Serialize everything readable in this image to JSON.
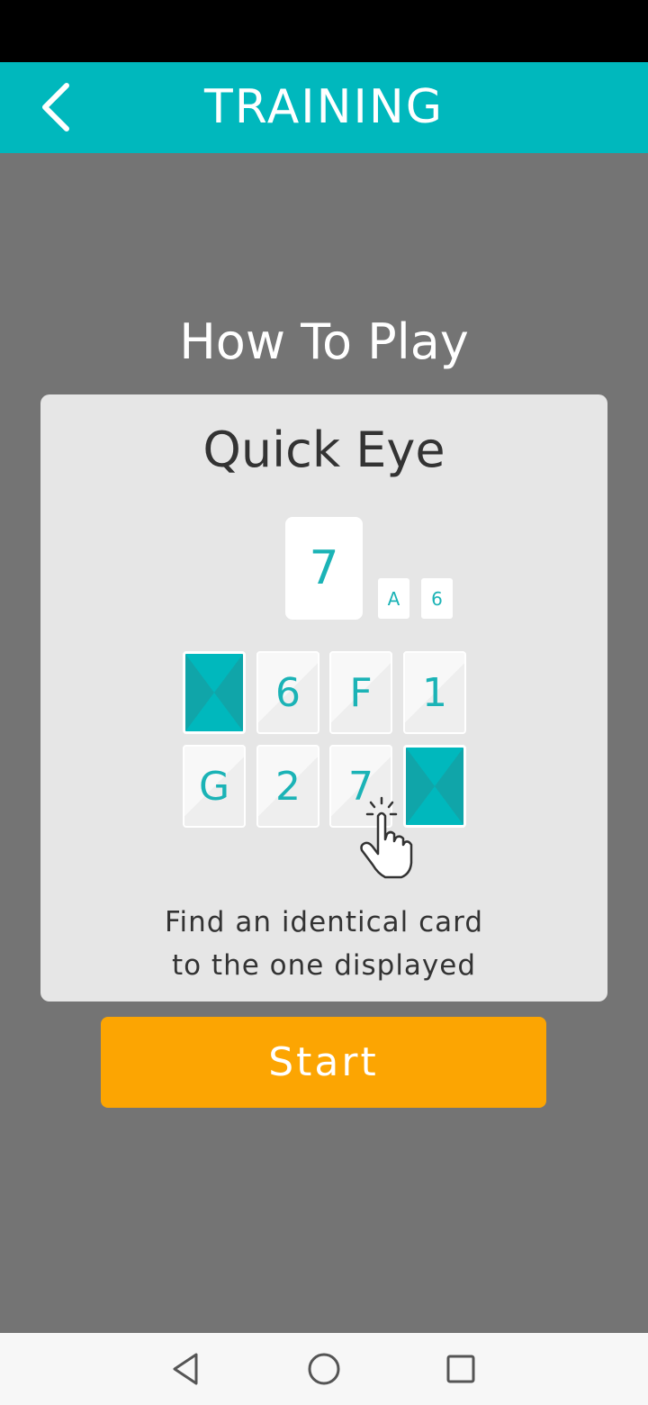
{
  "header": {
    "title": "TRAINING",
    "back_icon": "chevron-left-icon"
  },
  "instructions": {
    "heading": "How To Play",
    "game_title": "Quick Eye",
    "target_card": "7",
    "mini_cards": [
      "A",
      "6"
    ],
    "grid_row1": [
      "",
      "6",
      "F",
      "1"
    ],
    "grid_row2": [
      "G",
      "2",
      "7",
      ""
    ],
    "face_down_cards": [
      "row1-col1",
      "row2-col4"
    ],
    "tap_icon": "tap-hand-icon",
    "description_line1": "Find an identical card",
    "description_line2": "to the one displayed"
  },
  "start_button": {
    "label": "Start"
  },
  "nav": {
    "back_icon": "triangle-back-icon",
    "home_icon": "circle-home-icon",
    "recents_icon": "square-recents-icon"
  },
  "colors": {
    "accent": "#00b8bd",
    "button": "#fca502",
    "background": "#747474",
    "panel": "#e6e6e6",
    "card_text": "#1bb3b6"
  }
}
